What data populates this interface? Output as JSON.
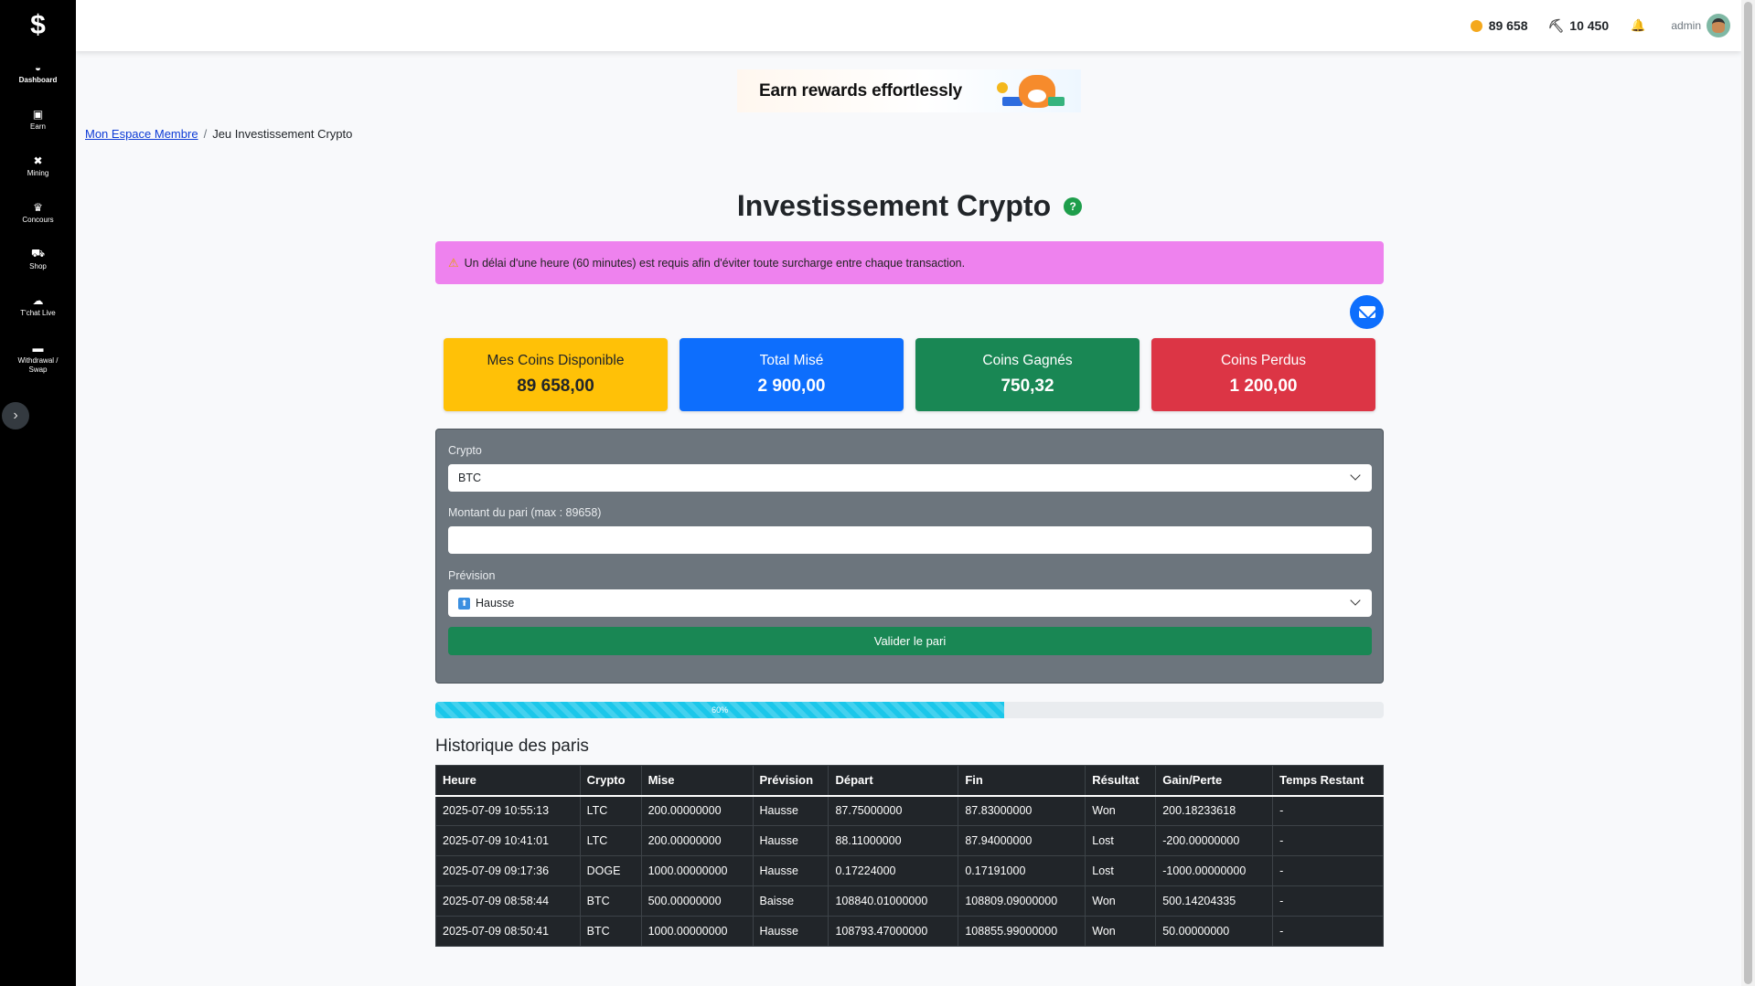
{
  "sidebar": {
    "logo": "$",
    "items": [
      {
        "label": "Dashboard",
        "icon": "dashboard-icon",
        "glyph": "◒"
      },
      {
        "label": "Earn",
        "icon": "money-icon",
        "glyph": "▣"
      },
      {
        "label": "Mining",
        "icon": "tools-icon",
        "glyph": "✖"
      },
      {
        "label": "Concours",
        "icon": "trophy-icon",
        "glyph": "♛"
      },
      {
        "label": "Shop",
        "icon": "cart-icon",
        "glyph": "⛟"
      },
      {
        "label": "T'chat Live",
        "icon": "chat-icon",
        "glyph": "☁"
      },
      {
        "label_line1": "Withdrawal /",
        "label_line2": "Swap",
        "icon": "wallet-icon",
        "glyph": "▬"
      }
    ],
    "toggle_glyph": "›"
  },
  "topbar": {
    "coins": "89 658",
    "pickaxe_glyph": "⛏",
    "mining": "10 450",
    "bell_glyph": "🔔",
    "username": "admin"
  },
  "banner": {
    "text": "Earn rewards effortlessly"
  },
  "breadcrumb": {
    "home": "Mon Espace Membre",
    "separator": "/",
    "current": "Jeu Investissement Crypto"
  },
  "page_title": "Investissement Crypto",
  "help_glyph": "?",
  "alert": {
    "icon": "⚠",
    "text": "Un délai d'une heure (60 minutes) est requis afin d'éviter toute surcharge entre chaque transaction."
  },
  "cards": [
    {
      "title": "Mes Coins Disponible",
      "value": "89 658,00",
      "color": "#ffc107"
    },
    {
      "title": "Total Misé",
      "value": "2 900,00",
      "color": "#0d6efd"
    },
    {
      "title": "Coins Gagnés",
      "value": "750,32",
      "color": "#198754"
    },
    {
      "title": "Coins Perdus",
      "value": "1 200,00",
      "color": "#dc3545"
    }
  ],
  "form": {
    "crypto_label": "Crypto",
    "crypto_value": "BTC",
    "amount_label": "Montant du pari (max : 89658)",
    "amount_value": "",
    "prevision_label": "Prévision",
    "prevision_icon": "⬆",
    "prevision_value": "Hausse",
    "submit_label": "Valider le pari"
  },
  "progress": {
    "label": "60%",
    "value": 0.6,
    "color": "#1bc7ea"
  },
  "history": {
    "title": "Historique des paris",
    "columns": [
      "Heure",
      "Crypto",
      "Mise",
      "Prévision",
      "Départ",
      "Fin",
      "Résultat",
      "Gain/Perte",
      "Temps Restant"
    ],
    "rows": [
      [
        "2025-07-09 10:55:13",
        "LTC",
        "200.00000000",
        "Hausse",
        "87.75000000",
        "87.83000000",
        "Won",
        "200.18233618",
        "-"
      ],
      [
        "2025-07-09 10:41:01",
        "LTC",
        "200.00000000",
        "Hausse",
        "88.11000000",
        "87.94000000",
        "Lost",
        "-200.00000000",
        "-"
      ],
      [
        "2025-07-09 09:17:36",
        "DOGE",
        "1000.00000000",
        "Hausse",
        "0.17224000",
        "0.17191000",
        "Lost",
        "-1000.00000000",
        "-"
      ],
      [
        "2025-07-09 08:58:44",
        "BTC",
        "500.00000000",
        "Baisse",
        "108840.01000000",
        "108809.09000000",
        "Won",
        "500.14204335",
        "-"
      ],
      [
        "2025-07-09 08:50:41",
        "BTC",
        "1000.00000000",
        "Hausse",
        "108793.47000000",
        "108855.99000000",
        "Won",
        "50.00000000",
        "-"
      ]
    ]
  }
}
